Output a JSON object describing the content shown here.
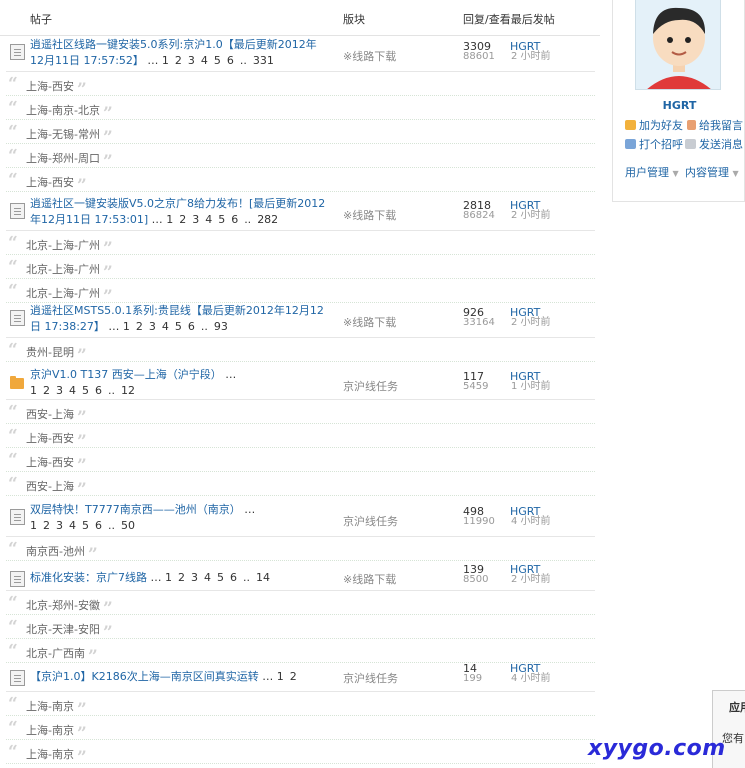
{
  "header": {
    "col_title": "帖子",
    "col_forum": "版块",
    "col_stats": "回复/查看最后发帖"
  },
  "threads": [
    {
      "icon": "document-icon",
      "title": "逍遥社区线路一键安装5.0系列:京沪1.0【最后更新2012年12月11日 17:57:52】",
      "pages": [
        "1",
        "2",
        "3",
        "4",
        "5",
        "6",
        "..",
        "331"
      ],
      "forum": "※线路下载",
      "replies": "3309",
      "views": "88601",
      "last_user": "HGRT",
      "last_time": "2 小时前",
      "subs": [
        "上海-西安",
        "上海-南京-北京",
        "上海-无锡-常州",
        "上海-郑州-周口",
        "上海-西安"
      ]
    },
    {
      "icon": "document-icon",
      "title": "逍遥社区一键安装版V5.0之京广8给力发布！[最后更新2012年12月11日 17:53:01]",
      "pages": [
        "1",
        "2",
        "3",
        "4",
        "5",
        "6",
        "..",
        "282"
      ],
      "forum": "※线路下载",
      "replies": "2818",
      "views": "86824",
      "last_user": "HGRT",
      "last_time": "2 小时前",
      "subs": [
        "北京-上海-广州",
        "北京-上海-广州",
        "北京-上海-广州"
      ]
    },
    {
      "icon": "document-icon",
      "title": "逍遥社区MSTS5.0.1系列:贵昆线【最后更新2012年12月12日 17:38:27】",
      "pages": [
        "1",
        "2",
        "3",
        "4",
        "5",
        "6",
        "..",
        "93"
      ],
      "forum": "※线路下载",
      "replies": "926",
      "views": "33164",
      "last_user": "HGRT",
      "last_time": "2 小时前",
      "subs": [
        "贵州-昆明"
      ]
    },
    {
      "icon": "folder-icon",
      "title": "京沪V1.0 T137 西安—上海（沪宁段）",
      "pages": [
        "1",
        "2",
        "3",
        "4",
        "5",
        "6",
        "..",
        "12"
      ],
      "forum": "京沪线任务",
      "replies": "117",
      "views": "5459",
      "last_user": "HGRT",
      "last_time": "1 小时前",
      "subs": [
        "西安-上海",
        "上海-西安",
        "上海-西安",
        "西安-上海"
      ]
    },
    {
      "icon": "document-icon",
      "title": "双层特快！T7777南京西——池州（南京）",
      "pages": [
        "1",
        "2",
        "3",
        "4",
        "5",
        "6",
        "..",
        "50"
      ],
      "forum": "京沪线任务",
      "replies": "498",
      "views": "11990",
      "last_user": "HGRT",
      "last_time": "4 小时前",
      "subs": [
        "南京西-池州"
      ]
    },
    {
      "icon": "document-icon",
      "title": "标准化安装：京广7线路",
      "pages": [
        "1",
        "2",
        "3",
        "4",
        "5",
        "6",
        "..",
        "14"
      ],
      "forum": "※线路下载",
      "replies": "139",
      "views": "8500",
      "last_user": "HGRT",
      "last_time": "2 小时前",
      "subs": [
        "北京-郑州-安徽",
        "北京-天津-安阳",
        "北京-广西南"
      ]
    },
    {
      "icon": "document-icon",
      "title": "【京沪1.0】K2186次上海—南京区间真实运转",
      "pages": [
        "1",
        "2"
      ],
      "forum": "京沪线任务",
      "replies": "14",
      "views": "199",
      "last_user": "HGRT",
      "last_time": "4 小时前",
      "subs": [
        "上海-南京",
        "上海-南京",
        "上海-南京"
      ]
    }
  ],
  "sidebar": {
    "username": "HGRT",
    "actions": {
      "add_friend": "加为好友",
      "leave_message": "给我留言",
      "greet": "打个招呼",
      "send_message": "发送消息"
    },
    "menus": {
      "user_manage": "用户管理",
      "content_manage": "内容管理"
    }
  },
  "popup": {
    "heading": "应用",
    "body": "您有"
  },
  "watermark": "xyygo.com",
  "colors": {
    "link": "#1f65a5",
    "meta": "#999999",
    "folder": "#f0a83c",
    "watermark": "#2a2ad8"
  }
}
